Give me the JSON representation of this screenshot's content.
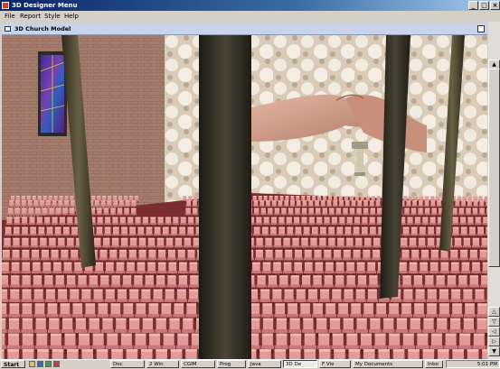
{
  "window": {
    "title": "3D Designer Menu",
    "min": "_",
    "max": "□",
    "close": "×"
  },
  "menu": {
    "items": [
      "File",
      "Report",
      "Style",
      "Help"
    ]
  },
  "inner_window": {
    "title": "3D Church Model"
  },
  "scrollbar": {
    "up": "▲",
    "down": "▼"
  },
  "nav": [
    "△",
    "▽",
    "◁",
    "▷",
    "○"
  ],
  "taskbar": {
    "start": "Start",
    "buttons": [
      "Doc",
      "2 Win",
      "CGIM",
      "Prog",
      "Java",
      "3D De",
      "F Vie",
      "My Documents",
      "Inbo"
    ],
    "active_index": 5,
    "tray": "5:01 PM"
  },
  "colors": {
    "titlebar": "#0a246a",
    "seat": "#d48a8a",
    "floor": "#7a2c30",
    "wall": "#a27a6a"
  }
}
